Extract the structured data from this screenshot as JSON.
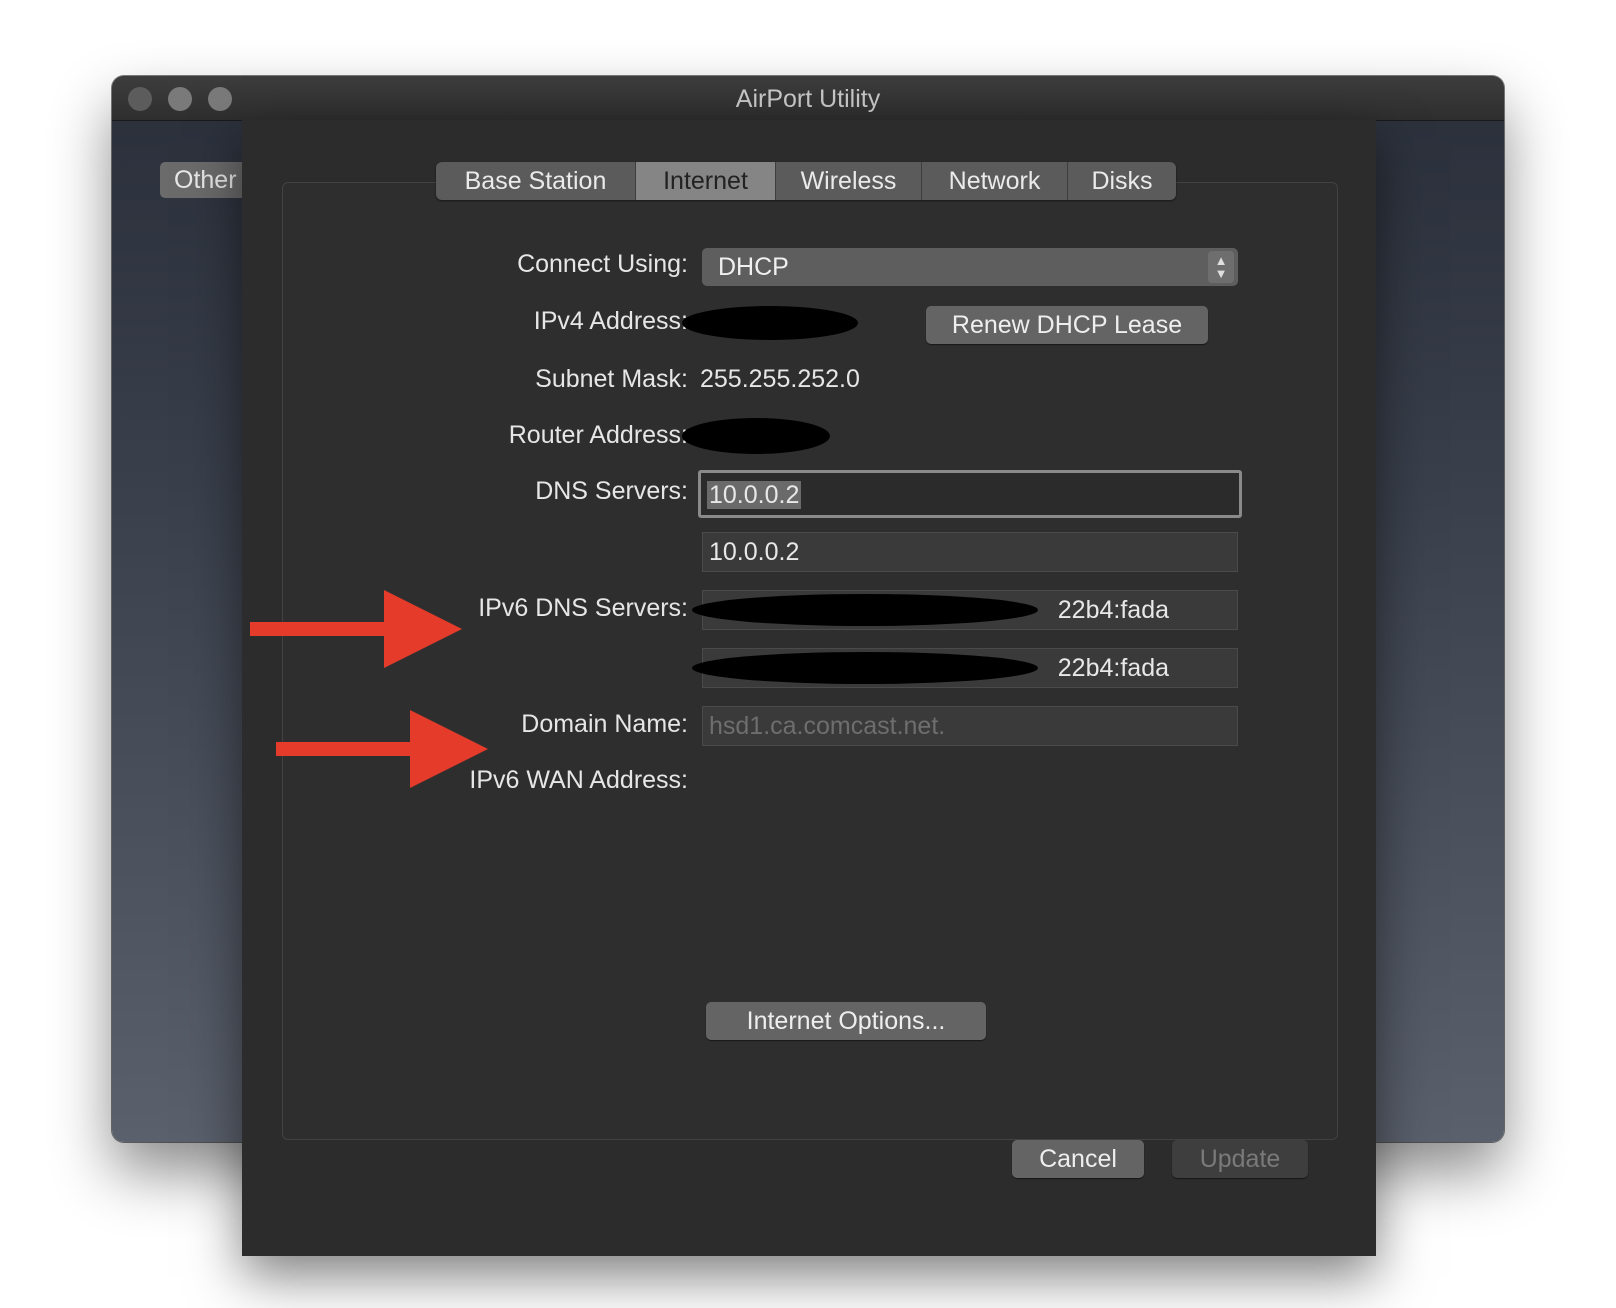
{
  "window": {
    "title": "AirPort Utility"
  },
  "sidebar": {
    "other_label": "Other"
  },
  "tabs": [
    {
      "label": "Base Station"
    },
    {
      "label": "Internet"
    },
    {
      "label": "Wireless"
    },
    {
      "label": "Network"
    },
    {
      "label": "Disks"
    }
  ],
  "form": {
    "connect_using": {
      "label": "Connect Using:",
      "value": "DHCP"
    },
    "ipv4": {
      "label": "IPv4 Address:"
    },
    "renew_button": "Renew DHCP Lease",
    "subnet": {
      "label": "Subnet Mask:",
      "value": "255.255.252.0"
    },
    "router": {
      "label": "Router Address:"
    },
    "dns": {
      "label": "DNS Servers:",
      "value1": "10.0.0.2",
      "value2": "10.0.0.2"
    },
    "ipv6_dns": {
      "label": "IPv6 DNS Servers:",
      "value1_suffix": "22b4:fada",
      "value2_suffix": "22b4:fada"
    },
    "domain": {
      "label": "Domain Name:",
      "placeholder": "hsd1.ca.comcast.net."
    },
    "ipv6_wan": {
      "label": "IPv6 WAN Address:"
    },
    "options_button": "Internet Options..."
  },
  "footer": {
    "cancel": "Cancel",
    "update": "Update"
  },
  "colors": {
    "arrow": "#e53b2a"
  }
}
